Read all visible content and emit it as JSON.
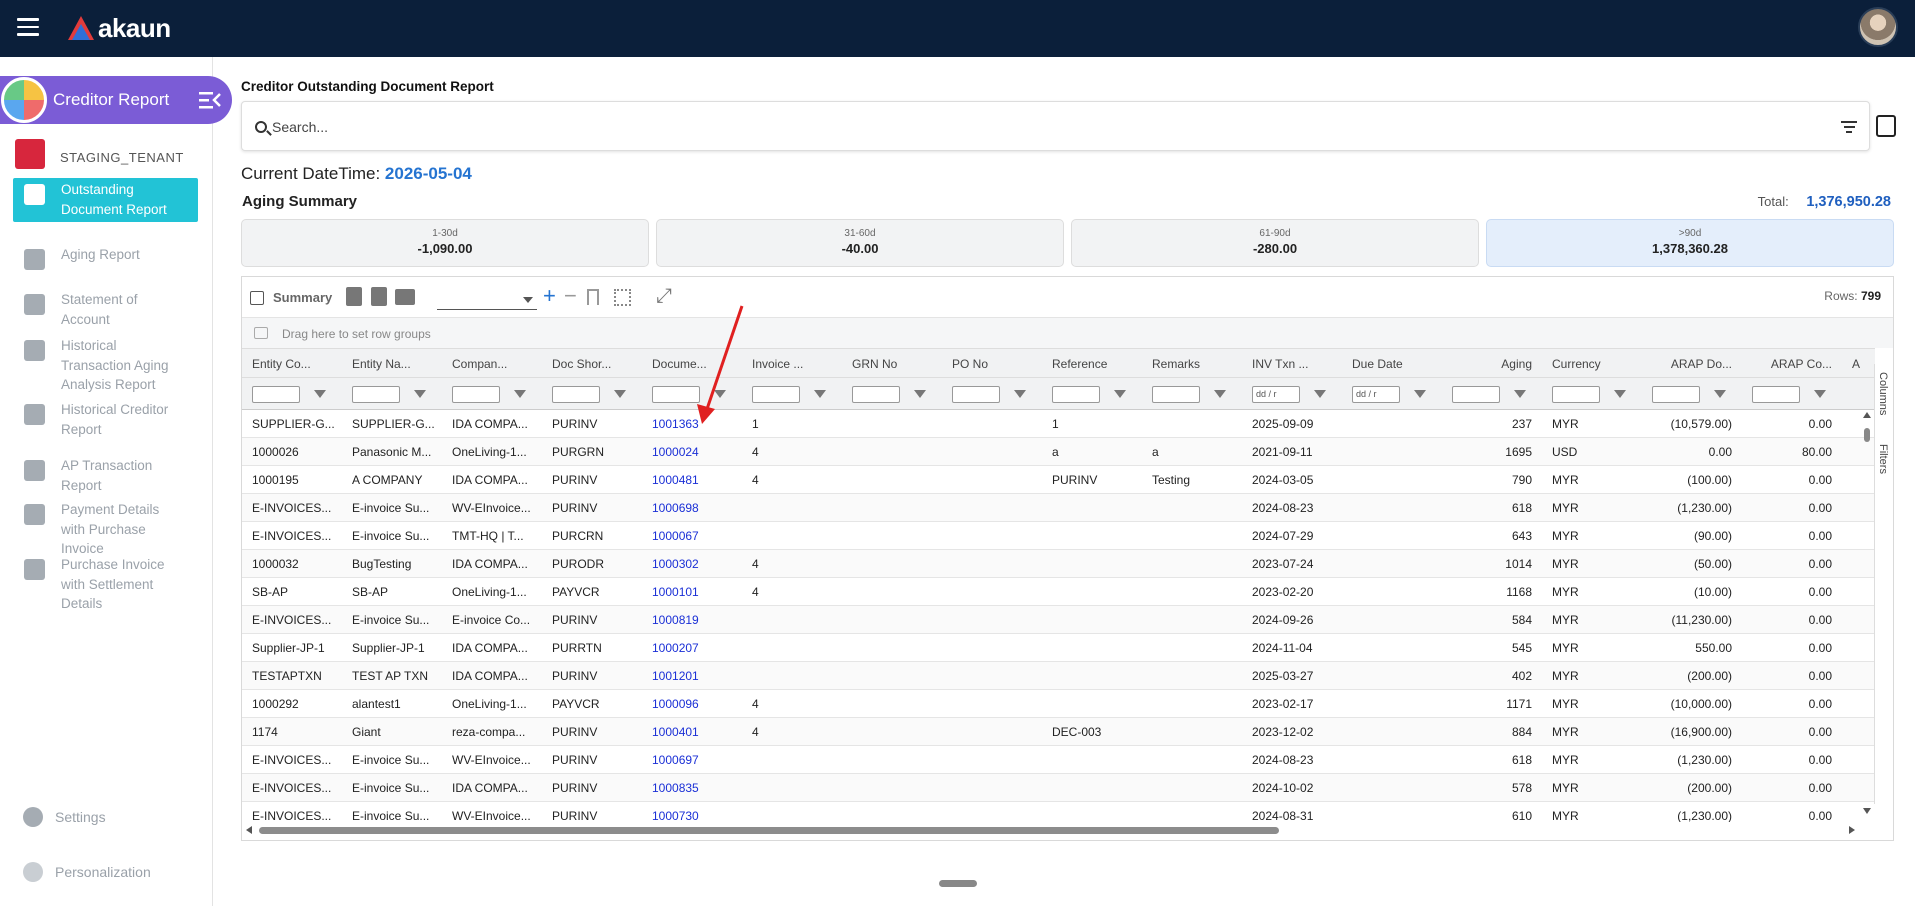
{
  "app": {
    "logo_text": "akaun",
    "title": "Creditor Report",
    "tenant": "STAGING_TENANT"
  },
  "sidebar": {
    "items": [
      {
        "label": "Outstanding Document Report",
        "icon": "alert-doc-icon",
        "active": true
      },
      {
        "label": "Aging Report",
        "icon": "clipboard-clock-icon"
      },
      {
        "label": "Statement of Account",
        "icon": "clipboard-user-icon"
      },
      {
        "label": "Historical Transaction Aging Analysis Report",
        "icon": "history-icon"
      },
      {
        "label": "Historical Creditor Report",
        "icon": "document-icon"
      },
      {
        "label": "AP Transaction Report",
        "icon": "card-icon"
      },
      {
        "label": "Payment Details with Purchase Invoice",
        "icon": "receipt-icon"
      },
      {
        "label": "Purchase Invoice with Settlement Details",
        "icon": "invoice-dollar-icon"
      }
    ],
    "settings_label": "Settings",
    "personalization_label": "Personalization"
  },
  "page": {
    "title": "Creditor Outstanding Document Report",
    "search_placeholder": "Search...",
    "datetime_label": "Current DateTime:",
    "datetime_value": "2026-05-04",
    "aging_title": "Aging Summary",
    "total_label": "Total:",
    "total_value": "1,376,950.28"
  },
  "aging_buckets": [
    {
      "label": "1-30d",
      "value": "-1,090.00"
    },
    {
      "label": "31-60d",
      "value": "-40.00"
    },
    {
      "label": "61-90d",
      "value": "-280.00"
    },
    {
      "label": ">90d",
      "value": "1,378,360.28"
    }
  ],
  "grid": {
    "summary_label": "Summary",
    "group_hint": "Drag here to set row groups",
    "rows_label": "Rows:",
    "rows_count": "799",
    "date_placeholder": "dd / r",
    "side_tabs": [
      "Columns",
      "Filters"
    ],
    "columns": [
      "Entity Co...",
      "Entity Na...",
      "Compan...",
      "Doc Shor...",
      "Docume...",
      "Invoice ...",
      "GRN No",
      "PO No",
      "Reference",
      "Remarks",
      "INV Txn ...",
      "Due Date",
      "Aging",
      "Currency",
      "ARAP Do...",
      "ARAP Co...",
      "A"
    ],
    "rows": [
      [
        "SUPPLIER-G...",
        "SUPPLIER-G...",
        "IDA COMPA...",
        "PURINV",
        "1001363",
        "1",
        "",
        "",
        "1",
        "",
        "2025-09-09",
        "",
        "237",
        "MYR",
        "(10,579.00)",
        "0.00"
      ],
      [
        "1000026",
        "Panasonic M...",
        "OneLiving-1...",
        "PURGRN",
        "1000024",
        "4",
        "",
        "",
        "a",
        "a",
        "2021-09-11",
        "",
        "1695",
        "USD",
        "0.00",
        "80.00"
      ],
      [
        "1000195",
        "A COMPANY",
        "IDA COMPA...",
        "PURINV",
        "1000481",
        "4",
        "",
        "",
        "PURINV",
        "Testing",
        "2024-03-05",
        "",
        "790",
        "MYR",
        "(100.00)",
        "0.00"
      ],
      [
        "E-INVOICES...",
        "E-invoice Su...",
        "WV-EInvoice...",
        "PURINV",
        "1000698",
        "",
        "",
        "",
        "",
        "",
        "2024-08-23",
        "",
        "618",
        "MYR",
        "(1,230.00)",
        "0.00"
      ],
      [
        "E-INVOICES...",
        "E-invoice Su...",
        "TMT-HQ | T...",
        "PURCRN",
        "1000067",
        "",
        "",
        "",
        "",
        "",
        "2024-07-29",
        "",
        "643",
        "MYR",
        "(90.00)",
        "0.00"
      ],
      [
        "1000032",
        "BugTesting",
        "IDA COMPA...",
        "PURODR",
        "1000302",
        "4",
        "",
        "",
        "",
        "",
        "2023-07-24",
        "",
        "1014",
        "MYR",
        "(50.00)",
        "0.00"
      ],
      [
        "SB-AP",
        "SB-AP",
        "OneLiving-1...",
        "PAYVCR",
        "1000101",
        "4",
        "",
        "",
        "",
        "",
        "2023-02-20",
        "",
        "1168",
        "MYR",
        "(10.00)",
        "0.00"
      ],
      [
        "E-INVOICES...",
        "E-invoice Su...",
        "E-invoice Co...",
        "PURINV",
        "1000819",
        "",
        "",
        "",
        "",
        "",
        "2024-09-26",
        "",
        "584",
        "MYR",
        "(11,230.00)",
        "0.00"
      ],
      [
        "Supplier-JP-1",
        "Supplier-JP-1",
        "IDA COMPA...",
        "PURRTN",
        "1000207",
        "",
        "",
        "",
        "",
        "",
        "2024-11-04",
        "",
        "545",
        "MYR",
        "550.00",
        "0.00"
      ],
      [
        "TESTAPTXN",
        "TEST AP TXN",
        "IDA COMPA...",
        "PURINV",
        "1001201",
        "",
        "",
        "",
        "",
        "",
        "2025-03-27",
        "",
        "402",
        "MYR",
        "(200.00)",
        "0.00"
      ],
      [
        "1000292",
        "alantest1",
        "OneLiving-1...",
        "PAYVCR",
        "1000096",
        "4",
        "",
        "",
        "",
        "",
        "2023-02-17",
        "",
        "1171",
        "MYR",
        "(10,000.00)",
        "0.00"
      ],
      [
        "1174",
        "Giant",
        "reza-compa...",
        "PURINV",
        "1000401",
        "4",
        "",
        "",
        "DEC-003",
        "",
        "2023-12-02",
        "",
        "884",
        "MYR",
        "(16,900.00)",
        "0.00"
      ],
      [
        "E-INVOICES...",
        "E-invoice Su...",
        "WV-EInvoice...",
        "PURINV",
        "1000697",
        "",
        "",
        "",
        "",
        "",
        "2024-08-23",
        "",
        "618",
        "MYR",
        "(1,230.00)",
        "0.00"
      ],
      [
        "E-INVOICES...",
        "E-invoice Su...",
        "IDA COMPA...",
        "PURINV",
        "1000835",
        "",
        "",
        "",
        "",
        "",
        "2024-10-02",
        "",
        "578",
        "MYR",
        "(200.00)",
        "0.00"
      ],
      [
        "E-INVOICES...",
        "E-invoice Su...",
        "WV-EInvoice...",
        "PURINV",
        "1000730",
        "",
        "",
        "",
        "",
        "",
        "2024-08-31",
        "",
        "610",
        "MYR",
        "(1,230.00)",
        "0.00"
      ]
    ]
  },
  "colors": {
    "topbar": "#0b1f3a",
    "app_pill": "#7b5cd6",
    "active_nav": "#22c3d6",
    "link": "#1a2fd6",
    "total_value": "#1f5fbf",
    "annotation_arrow": "#e02020"
  }
}
